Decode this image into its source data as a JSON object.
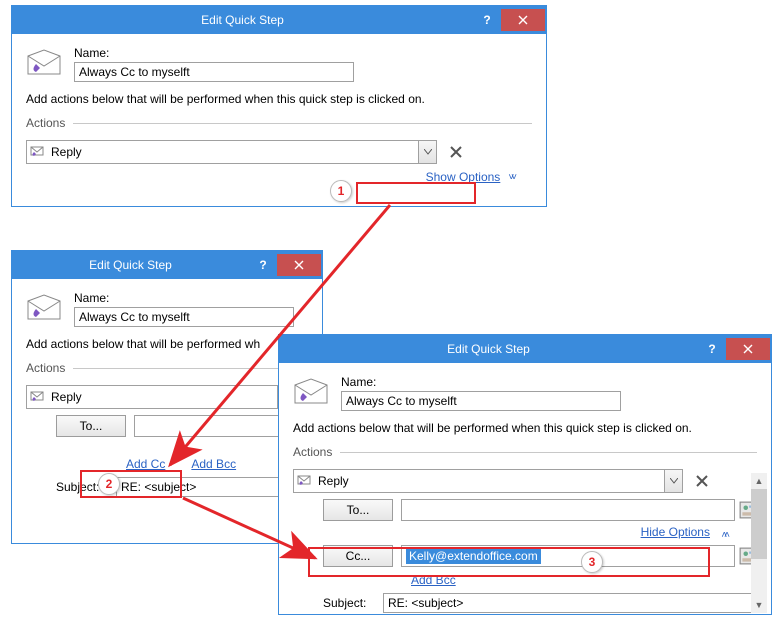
{
  "callouts": {
    "one": "1",
    "two": "2",
    "three": "3"
  },
  "dlg1": {
    "title": "Edit Quick Step",
    "help": "?",
    "nameLabel": "Name:",
    "nameValue": "Always Cc to myselft",
    "desc": "Add actions below that will be performed when this quick step is clicked on.",
    "actionsLabel": "Actions",
    "actionValue": "Reply",
    "showOptions": "Show Options"
  },
  "dlg2": {
    "title": "Edit Quick Step",
    "help": "?",
    "nameLabel": "Name:",
    "nameValue": "Always Cc to myselft",
    "descPartial": "Add actions below that will be performed wh",
    "actionsLabel": "Actions",
    "actionValue": "Reply",
    "toBtn": "To...",
    "addCc": "Add Cc",
    "addBcc": "Add Bcc",
    "subjectLabel": "Subject:",
    "subjectValue": "RE: <subject>"
  },
  "dlg3": {
    "title": "Edit Quick Step",
    "help": "?",
    "nameLabel": "Name:",
    "nameValue": "Always Cc to myselft",
    "desc": "Add actions below that will be performed when this quick step is clicked on.",
    "actionsLabel": "Actions",
    "actionValue": "Reply",
    "toBtn": "To...",
    "ccBtn": "Cc...",
    "ccValue": "Kelly@extendoffice.com",
    "hideOptions": "Hide Options",
    "addBcc": "Add Bcc",
    "subjectLabel": "Subject:",
    "subjectValue": "RE: <subject>"
  }
}
